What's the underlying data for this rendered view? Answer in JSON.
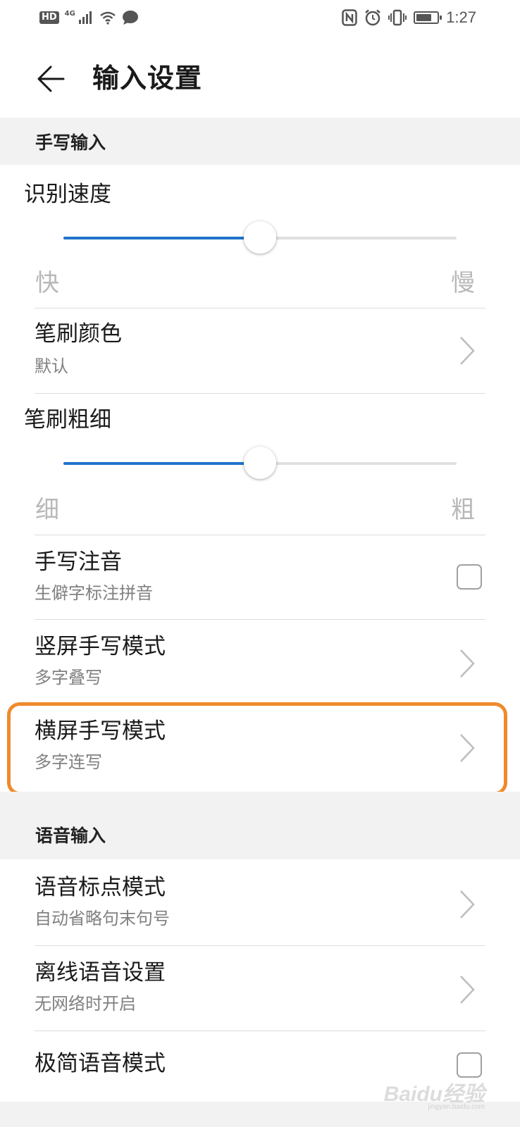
{
  "status_bar": {
    "hd": "HD",
    "network": "4G",
    "time": "1:27",
    "battery_level": 0.75,
    "icons": [
      "hd-icon",
      "signal-icon",
      "wifi-icon",
      "message-icon",
      "nfc-icon",
      "alarm-icon",
      "vibrate-icon",
      "battery-icon"
    ]
  },
  "header": {
    "title": "输入设置",
    "back_icon": "arrow-left-icon"
  },
  "handwriting": {
    "section_label": "手写输入",
    "recognition_speed": {
      "label": "识别速度",
      "min_label": "快",
      "max_label": "慢",
      "value": 0.5
    },
    "brush_color": {
      "title": "笔刷颜色",
      "subtitle": "默认"
    },
    "brush_thickness": {
      "label": "笔刷粗细",
      "min_label": "细",
      "max_label": "粗",
      "value": 0.5
    },
    "annotation": {
      "title": "手写注音",
      "subtitle": "生僻字标注拼音",
      "checked": false
    },
    "portrait_mode": {
      "title": "竖屏手写模式",
      "subtitle": "多字叠写"
    },
    "landscape_mode": {
      "title": "横屏手写模式",
      "subtitle": "多字连写",
      "highlight_color": "#f08a2c"
    }
  },
  "voice": {
    "section_label": "语音输入",
    "punctuation_mode": {
      "title": "语音标点模式",
      "subtitle": "自动省略句末句号"
    },
    "offline_settings": {
      "title": "离线语音设置",
      "subtitle": "无网络时开启"
    },
    "minimal_mode": {
      "title": "极简语音模式",
      "checked": false
    }
  },
  "colors": {
    "accent": "#2074cc",
    "section_bg": "#f2f2f2",
    "divider": "#dddddd",
    "subtitle": "#808080"
  },
  "watermark": {
    "text": "Baidu经验",
    "url": "jingyan.baidu.com"
  }
}
